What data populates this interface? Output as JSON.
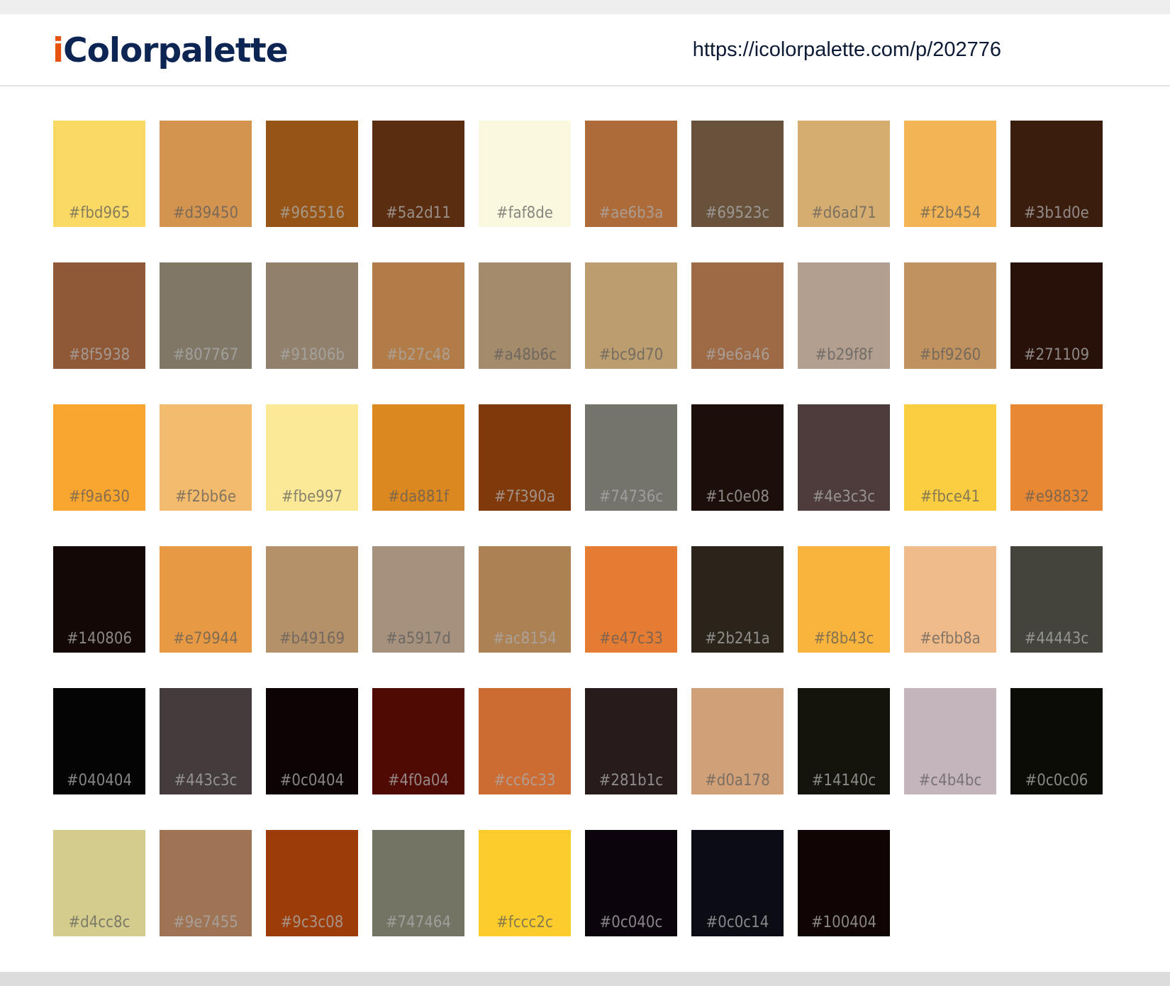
{
  "header": {
    "logo_first": "i",
    "logo_rest": "Colorpalette",
    "url": "https://icolorpalette.com/p/202776"
  },
  "swatches": [
    {
      "hex": "#fbd965"
    },
    {
      "hex": "#d39450"
    },
    {
      "hex": "#965516"
    },
    {
      "hex": "#5a2d11"
    },
    {
      "hex": "#faf8de"
    },
    {
      "hex": "#ae6b3a"
    },
    {
      "hex": "#69523c"
    },
    {
      "hex": "#d6ad71"
    },
    {
      "hex": "#f2b454"
    },
    {
      "hex": "#3b1d0e"
    },
    {
      "hex": "#8f5938"
    },
    {
      "hex": "#807767"
    },
    {
      "hex": "#91806b"
    },
    {
      "hex": "#b27c48"
    },
    {
      "hex": "#a48b6c"
    },
    {
      "hex": "#bc9d70"
    },
    {
      "hex": "#9e6a46"
    },
    {
      "hex": "#b29f8f"
    },
    {
      "hex": "#bf9260"
    },
    {
      "hex": "#271109"
    },
    {
      "hex": "#f9a630"
    },
    {
      "hex": "#f2bb6e"
    },
    {
      "hex": "#fbe997"
    },
    {
      "hex": "#da881f"
    },
    {
      "hex": "#7f390a"
    },
    {
      "hex": "#74736c"
    },
    {
      "hex": "#1c0e08"
    },
    {
      "hex": "#4e3c3c"
    },
    {
      "hex": "#fbce41"
    },
    {
      "hex": "#e98832"
    },
    {
      "hex": "#140806"
    },
    {
      "hex": "#e79944"
    },
    {
      "hex": "#b49169"
    },
    {
      "hex": "#a5917d"
    },
    {
      "hex": "#ac8154"
    },
    {
      "hex": "#e47c33"
    },
    {
      "hex": "#2b241a"
    },
    {
      "hex": "#f8b43c"
    },
    {
      "hex": "#efbb8a"
    },
    {
      "hex": "#44443c"
    },
    {
      "hex": "#040404"
    },
    {
      "hex": "#443c3c"
    },
    {
      "hex": "#0c0404"
    },
    {
      "hex": "#4f0a04"
    },
    {
      "hex": "#cc6c33"
    },
    {
      "hex": "#281b1c"
    },
    {
      "hex": "#d0a178"
    },
    {
      "hex": "#14140c"
    },
    {
      "hex": "#c4b4bc"
    },
    {
      "hex": "#0c0c06"
    },
    {
      "hex": "#d4cc8c"
    },
    {
      "hex": "#9e7455"
    },
    {
      "hex": "#9c3c08"
    },
    {
      "hex": "#747464"
    },
    {
      "hex": "#fccc2c"
    },
    {
      "hex": "#0c040c"
    },
    {
      "hex": "#0c0c14"
    },
    {
      "hex": "#100404"
    }
  ]
}
